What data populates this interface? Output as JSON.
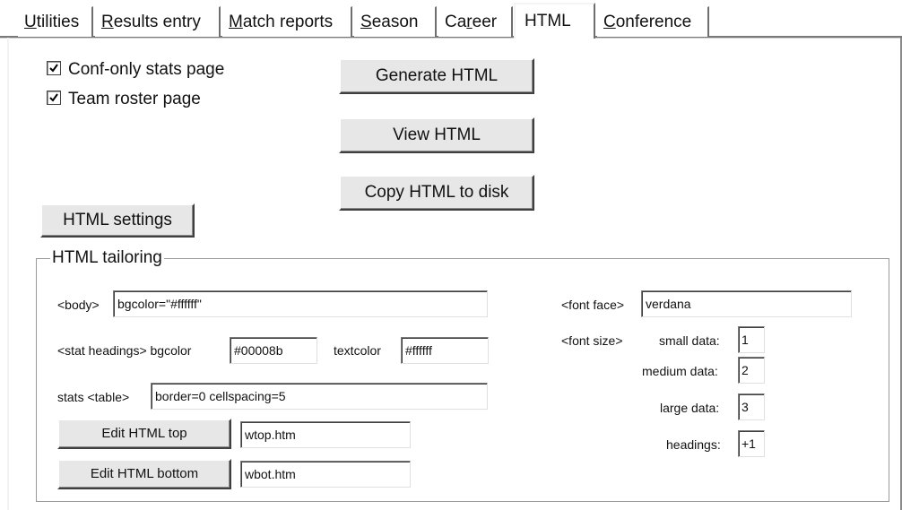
{
  "tabs": [
    {
      "pre": "",
      "ul": "U",
      "post": "tilities"
    },
    {
      "pre": "",
      "ul": "R",
      "post": "esults entry"
    },
    {
      "pre": "",
      "ul": "M",
      "post": "atch reports"
    },
    {
      "pre": "",
      "ul": "S",
      "post": "eason"
    },
    {
      "pre": "Ca",
      "ul": "r",
      "post": "eer"
    },
    {
      "pre": "HTML",
      "ul": "",
      "post": ""
    },
    {
      "pre": "",
      "ul": "C",
      "post": "onference"
    }
  ],
  "active_tab": "HTML",
  "options": {
    "conf_only_label": "Conf-only stats page",
    "conf_only_checked": true,
    "team_roster_label": "Team roster page",
    "team_roster_checked": true
  },
  "actions": {
    "generate": "Generate HTML",
    "view": "View HTML",
    "copy": "Copy HTML to disk",
    "settings": "HTML settings"
  },
  "tailoring": {
    "title": "HTML tailoring",
    "body_label": "<body>",
    "body_value": "bgcolor=\"#ffffff\"",
    "stat_headings_label": "<stat headings>  bgcolor",
    "stat_headings_bgcolor": "#00008b",
    "textcolor_label": "textcolor",
    "textcolor_value": "#ffffff",
    "stats_table_label": "stats <table>",
    "stats_table_value": "border=0 cellspacing=5",
    "edit_top_button": "Edit HTML top",
    "edit_top_file": "wtop.htm",
    "edit_bottom_button": "Edit HTML bottom",
    "edit_bottom_file": "wbot.htm",
    "font_face_label": "<font face>",
    "font_face_value": "verdana",
    "font_size_label": "<font size>",
    "small_data_label": "small data:",
    "small_data_value": "1",
    "medium_data_label": "medium data:",
    "medium_data_value": "2",
    "large_data_label": "large data:",
    "large_data_value": "3",
    "headings_label": "headings:",
    "headings_value": "+1"
  }
}
